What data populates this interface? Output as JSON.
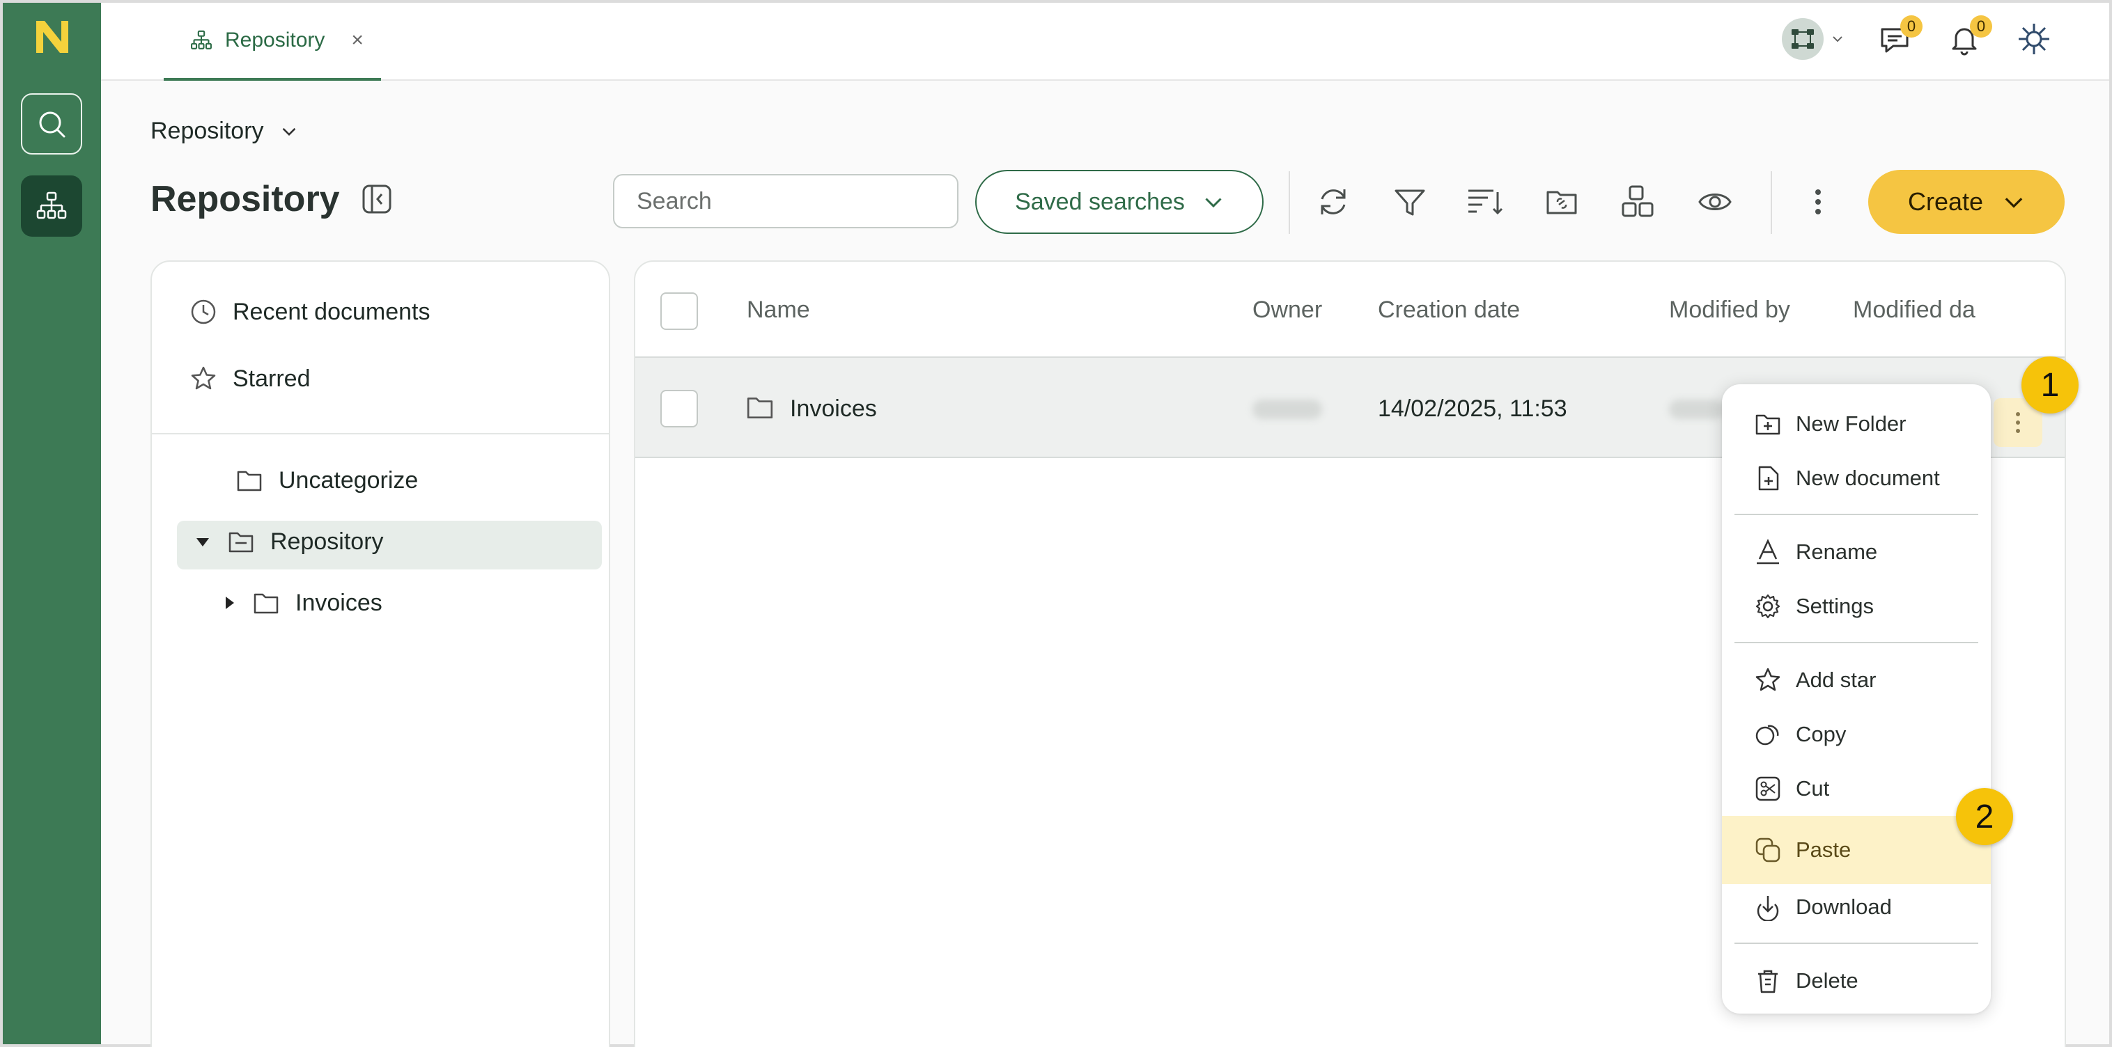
{
  "tab": {
    "label": "Repository",
    "close": "×"
  },
  "notifications": {
    "messages_count": "0",
    "alerts_count": "0"
  },
  "breadcrumb": {
    "label": "Repository"
  },
  "page": {
    "title": "Repository"
  },
  "search": {
    "placeholder": "Search"
  },
  "saved_searches": {
    "label": "Saved searches"
  },
  "create": {
    "label": "Create"
  },
  "sidebar": {
    "recent": "Recent documents",
    "starred": "Starred",
    "tree": [
      {
        "label": "Uncategorize"
      },
      {
        "label": "Repository"
      },
      {
        "label": "Invoices"
      }
    ]
  },
  "table": {
    "columns": [
      "Name",
      "Owner",
      "Creation date",
      "Modified by",
      "Modified da"
    ],
    "rows": [
      {
        "name": "Invoices",
        "creation_date": "14/02/2025, 11:53"
      }
    ]
  },
  "context_menu": {
    "items": [
      {
        "label": "New Folder"
      },
      {
        "label": "New document"
      },
      {
        "label": "Rename"
      },
      {
        "label": "Settings"
      },
      {
        "label": "Add star"
      },
      {
        "label": "Copy"
      },
      {
        "label": "Cut"
      },
      {
        "label": "Paste"
      },
      {
        "label": "Download"
      },
      {
        "label": "Delete"
      }
    ]
  },
  "steps": {
    "one": "1",
    "two": "2"
  },
  "colors": {
    "rail": "#3d7a55",
    "rail_active": "#1c4731",
    "accent_yellow": "#f5c542",
    "primary_green": "#2f6b48",
    "menu_highlight": "#fdf2c8"
  }
}
